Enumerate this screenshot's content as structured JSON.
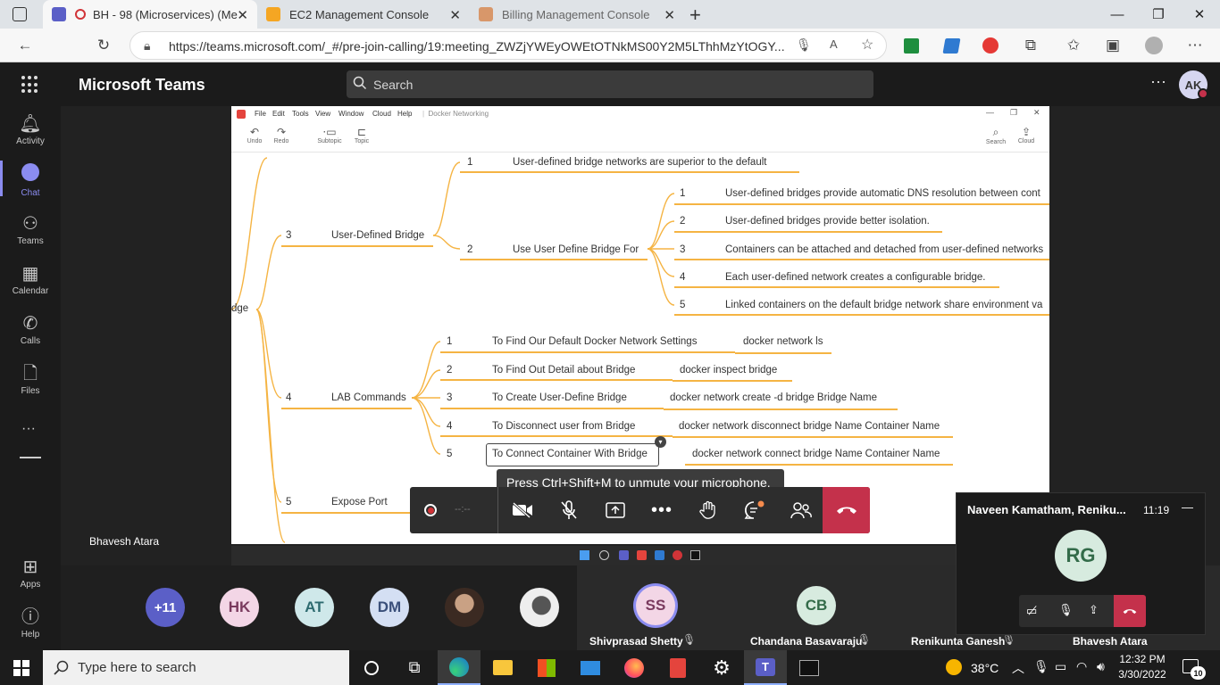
{
  "browser": {
    "tabs": [
      {
        "title": "BH - 98 (Microservices) (Me",
        "active": true,
        "favicon": "teams-icon",
        "color": "#5b5fc7"
      },
      {
        "title": "EC2 Management Console",
        "active": false,
        "favicon": "aws-icon",
        "color": "#f5a623"
      },
      {
        "title": "Billing Management Console",
        "active": false,
        "favicon": "aws-box-icon",
        "color": "#d8976a"
      }
    ],
    "url": "https://teams.microsoft.com/_#/pre-join-calling/19:meeting_ZWZjYWEyOWEtOTNkMS00Y2M5LThhMzYtOGY..."
  },
  "teams": {
    "app_name": "Microsoft Teams",
    "search_placeholder": "Search",
    "user_initials": "AK",
    "rail": [
      {
        "label": "Activity",
        "icon": "bell-icon"
      },
      {
        "label": "Chat",
        "icon": "chat-icon",
        "selected": true
      },
      {
        "label": "Teams",
        "icon": "teams-icon"
      },
      {
        "label": "Calendar",
        "icon": "calendar-icon"
      },
      {
        "label": "Calls",
        "icon": "phone-icon"
      },
      {
        "label": "Files",
        "icon": "file-icon"
      },
      {
        "label": "Apps",
        "icon": "apps-icon"
      },
      {
        "label": "Help",
        "icon": "help-icon"
      }
    ]
  },
  "shared_screen": {
    "app_menu": [
      "File",
      "Edit",
      "Tools",
      "View",
      "Window",
      "Cloud",
      "Help"
    ],
    "doc_title": "Docker Networking",
    "tools": [
      "Undo",
      "Redo",
      "Subtopic",
      "Topic",
      "Search",
      "Cloud"
    ],
    "root_fragment": "dge",
    "mindmap": {
      "branch3": {
        "num": "3",
        "label": "User-Defined Bridge"
      },
      "b3_1": {
        "num": "1",
        "label": "User-defined bridge networks are superior to the default"
      },
      "b3_2": {
        "num": "2",
        "label": "Use User Define Bridge For"
      },
      "b3_2_items": [
        {
          "num": "1",
          "label": "User-defined bridges provide automatic DNS resolution between cont"
        },
        {
          "num": "2",
          "label": "User-defined bridges provide better isolation."
        },
        {
          "num": "3",
          "label": "Containers can be attached and detached from user-defined networks"
        },
        {
          "num": "4",
          "label": "Each user-defined network creates a configurable bridge."
        },
        {
          "num": "5",
          "label": "Linked containers on the default bridge network share environment va"
        }
      ],
      "branch4": {
        "num": "4",
        "label": "LAB Commands"
      },
      "lab": [
        {
          "num": "1",
          "label": "To Find Our Default Docker Network Settings",
          "cmd": "docker network ls"
        },
        {
          "num": "2",
          "label": "To Find Out Detail about Bridge",
          "cmd": "docker inspect bridge"
        },
        {
          "num": "3",
          "label": "To Create User-Define Bridge",
          "cmd": "docker network create -d bridge Bridge Name"
        },
        {
          "num": "4",
          "label": "To Disconnect user from Bridge",
          "cmd": "docker network disconnect bridge Name Container Name"
        },
        {
          "num": "5",
          "label": "To Connect Container With Bridge",
          "cmd": "docker network connect bridge Name Container Name"
        }
      ],
      "branch5": {
        "num": "5",
        "label": "Expose Port"
      }
    }
  },
  "meeting": {
    "presenter_name": "Bhavesh Atara",
    "timer": "--:--",
    "tooltip": "Press Ctrl+Shift+M to unmute your microphone.",
    "participants": [
      {
        "initials": "+11",
        "color": "#5b5fc7",
        "text_color": "#ffffff"
      },
      {
        "initials": "HK",
        "color": "#f3d6e6",
        "text_color": "#7a3a5e"
      },
      {
        "initials": "AT",
        "color": "#cfe8ea",
        "text_color": "#2e6b70"
      },
      {
        "initials": "DM",
        "color": "#d4dff3",
        "text_color": "#3a4f7a"
      }
    ],
    "tiles": [
      {
        "initials": "SS",
        "name": "Shivprasad Shetty",
        "color": "#f3d6e6",
        "text_color": "#7a3a5e"
      },
      {
        "initials": "CB",
        "name": "Chandana Basavaraju",
        "color": "#d7ebdf",
        "text_color": "#336b49"
      },
      {
        "name": "Renikunta Ganesh"
      },
      {
        "name": "Bhavesh Atara"
      }
    ],
    "mini_window": {
      "title": "Naveen Kamatham, Reniku...",
      "time": "11:19",
      "initials": "RG"
    }
  },
  "taskbar": {
    "search_placeholder": "Type here to search",
    "temperature": "38°C",
    "time": "12:32 PM",
    "date": "3/30/2022",
    "notifications": "10"
  }
}
